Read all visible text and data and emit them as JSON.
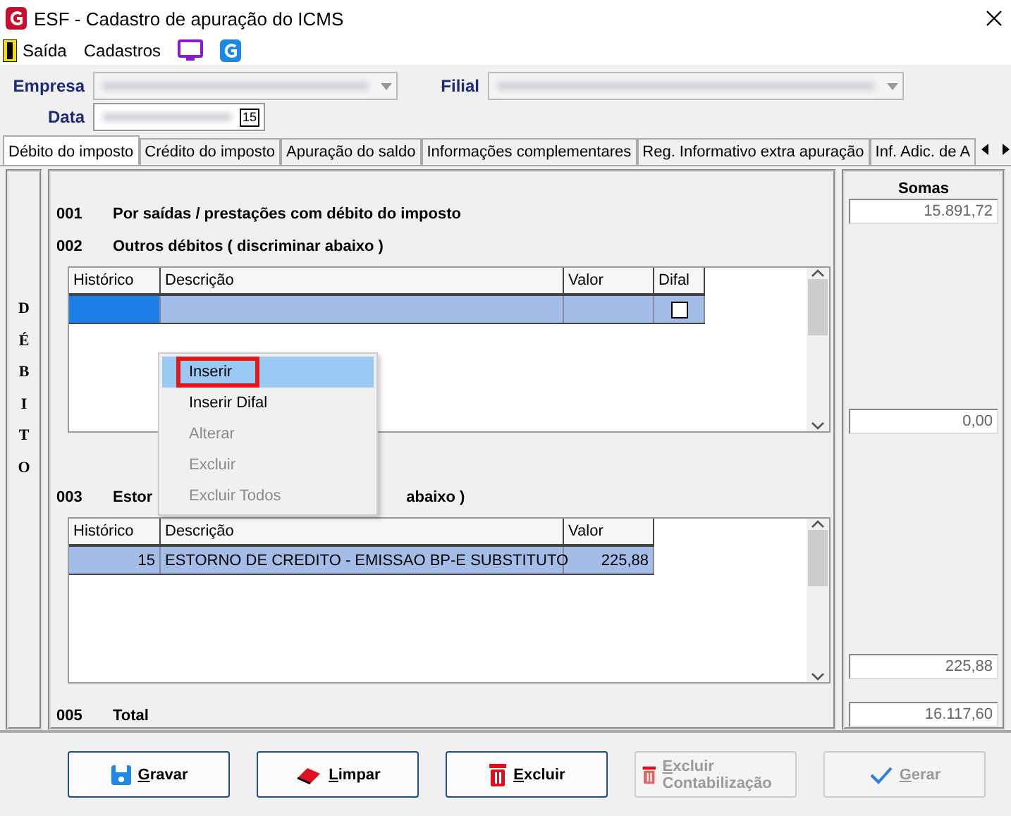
{
  "window": {
    "title": "ESF - Cadastro de apuração do ICMS"
  },
  "menu": [
    {
      "kind": "door",
      "label": "Saída"
    },
    {
      "kind": "text",
      "label": "Cadastros"
    },
    {
      "kind": "monitor"
    },
    {
      "kind": "logo"
    }
  ],
  "form": {
    "empresa_label": "Empresa",
    "filial_label": "Filial",
    "data_label": "Data",
    "calendar_day": "15"
  },
  "tabs": [
    {
      "label": "Débito do imposto",
      "selected": true
    },
    {
      "label": "Crédito do imposto",
      "selected": false
    },
    {
      "label": "Apuração do saldo",
      "selected": false
    },
    {
      "label": "Informações complementares",
      "selected": false
    },
    {
      "label": "Reg. Informativo extra apuração",
      "selected": false
    },
    {
      "label": "Inf. Adic. de A",
      "selected": false
    }
  ],
  "side_label": "DÉBITO",
  "sums_title": "Somas",
  "line_001": {
    "code": "001",
    "text": "Por saídas / prestações com débito do imposto",
    "sum": "15.891,72"
  },
  "line_002": {
    "code": "002",
    "text": "Outros débitos ( discriminar abaixo )",
    "sum": "0,00",
    "columns": [
      "Histórico",
      "Descrição",
      "Valor",
      "Difal"
    ],
    "rows": [
      {
        "selected": true,
        "difal_checked": false
      }
    ]
  },
  "line_003": {
    "code": "003",
    "text_start": "Estor",
    "text_end": "abaixo )",
    "sum": "225,88",
    "columns": [
      "Histórico",
      "Descrição",
      "Valor"
    ],
    "rows": [
      {
        "historico": "15",
        "descricao": "ESTORNO DE CREDITO - EMISSAO BP-E SUBSTITUTO",
        "valor": "225,88",
        "selected": true
      }
    ]
  },
  "total": {
    "code": "005",
    "text": "Total",
    "sum": "16.117,60"
  },
  "context_menu": [
    {
      "label": "Inserir",
      "selected": true,
      "disabled": false
    },
    {
      "label": "Inserir Difal",
      "selected": false,
      "disabled": false
    },
    {
      "label": "Alterar",
      "selected": false,
      "disabled": true
    },
    {
      "label": "Excluir",
      "selected": false,
      "disabled": true
    },
    {
      "label": "Excluir Todos",
      "selected": false,
      "disabled": true
    }
  ],
  "buttons": [
    {
      "kind": "save",
      "label": "Gravar",
      "disabled": false
    },
    {
      "kind": "eraser",
      "label": "Limpar",
      "disabled": false
    },
    {
      "kind": "trash",
      "label": "Excluir",
      "disabled": false
    },
    {
      "kind": "trash",
      "label": "Excluir Contabilização",
      "disabled": true
    },
    {
      "kind": "check",
      "label": "Gerar",
      "disabled": true
    }
  ]
}
